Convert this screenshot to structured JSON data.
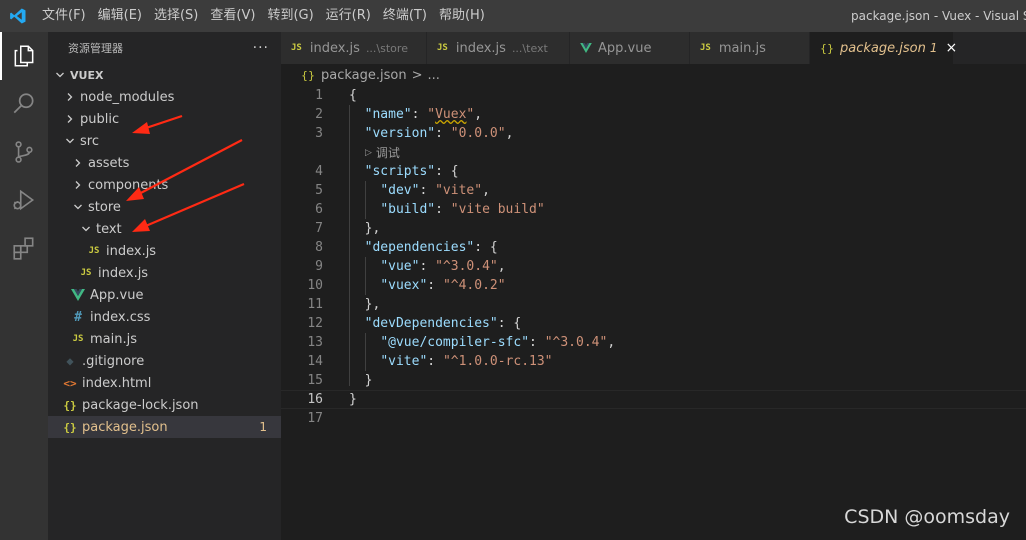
{
  "menu": [
    "文件(F)",
    "编辑(E)",
    "选择(S)",
    "查看(V)",
    "转到(G)",
    "运行(R)",
    "终端(T)",
    "帮助(H)"
  ],
  "window_title": "package.json - Vuex - Visual Studio Code",
  "sidebar": {
    "title": "资源管理器",
    "more": "···",
    "section": "VUEX",
    "tree": [
      {
        "label": "node_modules",
        "type": "folder",
        "open": false
      },
      {
        "label": "public",
        "type": "folder",
        "open": false
      },
      {
        "label": "src",
        "type": "folder",
        "open": true
      },
      {
        "label": "assets",
        "type": "folder",
        "open": false
      },
      {
        "label": "components",
        "type": "folder",
        "open": false
      },
      {
        "label": "store",
        "type": "folder",
        "open": true
      },
      {
        "label": "text",
        "type": "folder",
        "open": true
      },
      {
        "label": "index.js",
        "type": "js"
      },
      {
        "label": "index.js",
        "type": "js"
      },
      {
        "label": "App.vue",
        "type": "vue"
      },
      {
        "label": "index.css",
        "type": "css"
      },
      {
        "label": "main.js",
        "type": "js"
      },
      {
        "label": ".gitignore",
        "type": "git"
      },
      {
        "label": "index.html",
        "type": "html"
      },
      {
        "label": "package-lock.json",
        "type": "json"
      },
      {
        "label": "package.json",
        "type": "json",
        "badge": "1"
      }
    ]
  },
  "tabs": [
    {
      "label": "index.js",
      "desc": "...\\store",
      "icon": "JS"
    },
    {
      "label": "index.js",
      "desc": "...\\text",
      "icon": "JS"
    },
    {
      "label": "App.vue",
      "icon": "vue"
    },
    {
      "label": "main.js",
      "icon": "JS"
    },
    {
      "label": "package.json",
      "icon": "{}",
      "problems": "1",
      "close": "×"
    }
  ],
  "breadcrumb": {
    "icon": "{}",
    "file": "package.json",
    "sep": ">",
    "more": "..."
  },
  "editor": {
    "line_numbers": [
      "1",
      "2",
      "3",
      "4",
      "5",
      "6",
      "7",
      "8",
      "9",
      "10",
      "11",
      "12",
      "13",
      "14",
      "15",
      "16",
      "17"
    ],
    "codelens": "调试",
    "current_line": "16"
  },
  "watermark": "CSDN @oomsday",
  "colors": {
    "accent": "#007acc",
    "modified": "#e2c08d",
    "arrow": "#ff2a14"
  }
}
